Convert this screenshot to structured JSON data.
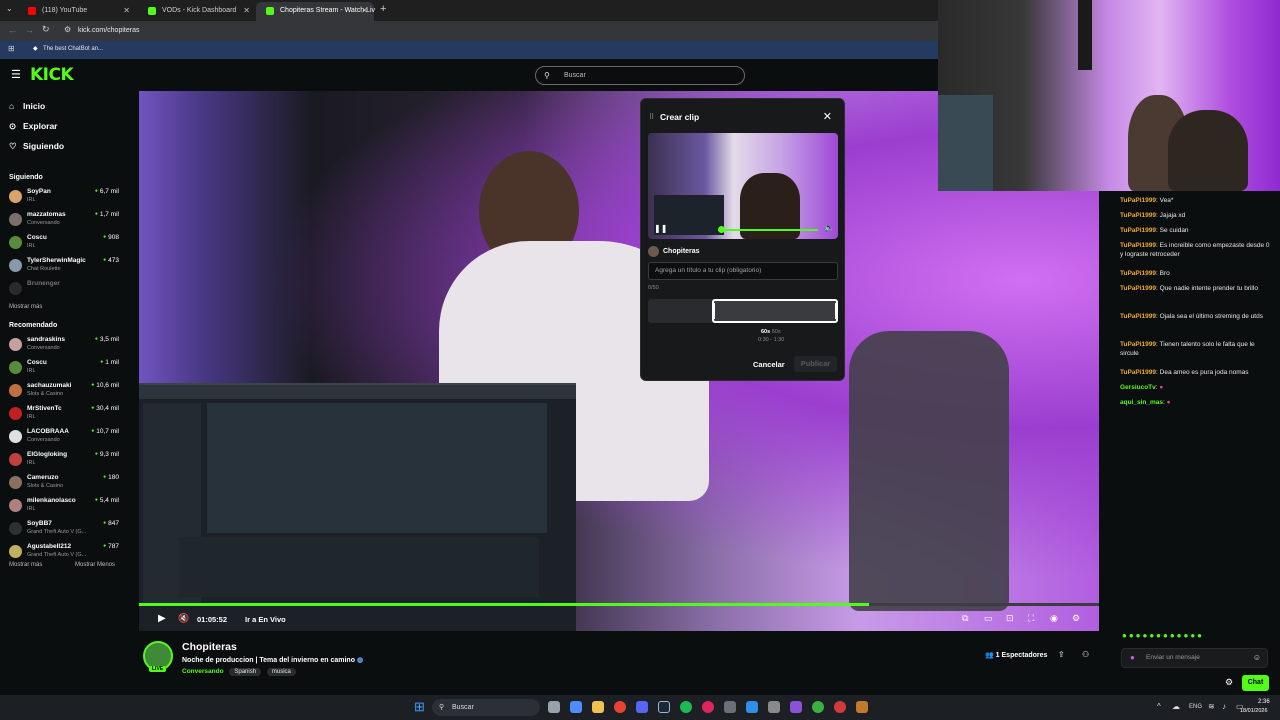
{
  "browser": {
    "tabs": [
      {
        "title": "(118) YouTube",
        "color": "#ff0000"
      },
      {
        "title": "VODs - Kick Dashboard",
        "color": "#53fc18"
      },
      {
        "title": "Chopiteras Stream - Watch Liv",
        "color": "#53fc18"
      }
    ],
    "url": "kick.com/chopiteras",
    "bookmark": "The best ChatBot an..."
  },
  "kick": {
    "logo": "KICK",
    "search_placeholder": "Buscar",
    "nav": [
      {
        "label": "Inicio",
        "icon": "home-icon"
      },
      {
        "label": "Explorar",
        "icon": "compass-icon"
      },
      {
        "label": "Siguiendo",
        "icon": "heart-icon"
      }
    ],
    "following_title": "Siguiendo",
    "following": [
      {
        "name": "SoyPan",
        "category": "IRL",
        "viewers": "6,7 mil",
        "color": "#d9a46b"
      },
      {
        "name": "mazzatomas",
        "category": "Conversando",
        "viewers": "1,7 mil",
        "color": "#7a6f6a"
      },
      {
        "name": "Coscu",
        "category": "IRL",
        "viewers": "908",
        "color": "#5a8a3a"
      },
      {
        "name": "TylerSherwinMagic",
        "category": "Chat Roulette",
        "viewers": "473",
        "color": "#8899aa"
      },
      {
        "name": "Brunenger",
        "category": "",
        "viewers": "",
        "color": "#555555"
      }
    ],
    "show_more_following": "Mostrar más",
    "recommended_title": "Recomendado",
    "recommended": [
      {
        "name": "sandraskins",
        "category": "Conversando",
        "viewers": "3,5 mil",
        "color": "#c8a0a0"
      },
      {
        "name": "Coscu",
        "category": "IRL",
        "viewers": "1 mil",
        "color": "#5a8a3a"
      },
      {
        "name": "sachauzumaki",
        "category": "Slots & Casino",
        "viewers": "10,6 mil",
        "color": "#c07040"
      },
      {
        "name": "MrStivenTc",
        "category": "IRL",
        "viewers": "30,4 mil",
        "color": "#c02020"
      },
      {
        "name": "LACOBRAAA",
        "category": "Conversando",
        "viewers": "10,7 mil",
        "color": "#e0e0e0"
      },
      {
        "name": "ElGlogloking",
        "category": "IRL",
        "viewers": "9,3 mil",
        "color": "#c04040"
      },
      {
        "name": "Cameruzo",
        "category": "Slots & Casino",
        "viewers": "180",
        "color": "#8a7060"
      },
      {
        "name": "milenkanolasco",
        "category": "IRL",
        "viewers": "5,4 mil",
        "color": "#b08080"
      },
      {
        "name": "SoyBB7",
        "category": "Grand Theft Auto V (G...",
        "viewers": "847",
        "color": "#303030"
      },
      {
        "name": "Agustabell212",
        "category": "Grand Theft Auto V (G...",
        "viewers": "787",
        "color": "#c0b060"
      }
    ],
    "show_more": "Mostrar más",
    "show_less": "Mostrar Menos"
  },
  "player": {
    "time": "01:05:52",
    "go_live": "Ir a En Vivo",
    "progress": 0.76
  },
  "clip_modal": {
    "title": "Crear clip",
    "streamer": "Chopiteras",
    "title_placeholder": "Agrega un título a tu clip (obligatorio)",
    "char_count": "0/50",
    "duration": "60s",
    "duration_max": "60s",
    "range": "0:30 - 1:30",
    "cancel": "Cancelar",
    "publish": "Publicar"
  },
  "channel": {
    "name": "Chopiteras",
    "stream_title": "Noche de produccion | Tema del invierno en camino",
    "category": "Conversando",
    "tags": [
      "Spanish",
      "musica"
    ],
    "live_badge": "LIVE",
    "viewers": "1 Espectadores"
  },
  "chat": {
    "messages": [
      {
        "user": "TuPaPi1999",
        "text": "Vea*",
        "green": false
      },
      {
        "user": "TuPaPi1999",
        "text": "Jajaja xd",
        "green": false
      },
      {
        "user": "TuPaPi1999",
        "text": "Se cuidan",
        "green": false
      },
      {
        "user": "TuPaPi1999",
        "text": "Es increible como empezaste desde 0 y lograste retroceder",
        "green": false
      },
      {
        "user": "TuPaPi1999",
        "text": "Bro",
        "green": false
      },
      {
        "user": "TuPaPi1999",
        "text": "Que nadie intente prender tu brillo",
        "green": false
      },
      {
        "user": "TuPaPi1999",
        "text": "Ojala sea el último streming de utds",
        "green": false
      },
      {
        "user": "TuPaPi1999",
        "text": "Tienen talento solo le falta que le sircule",
        "green": false
      },
      {
        "user": "TuPaPi1999",
        "text": "Dea ameo es pura joda nomas",
        "green": false
      },
      {
        "user": "GersiucoTv",
        "text": "",
        "green": true
      },
      {
        "user": "aqui_sin_mas",
        "text": "",
        "green": true
      }
    ],
    "input_placeholder": "Enviar un mensaje",
    "send_label": "Chat"
  },
  "taskbar": {
    "search": "Buscar",
    "lang": "ENG",
    "time": "2:36",
    "date": "18/01/2026"
  }
}
